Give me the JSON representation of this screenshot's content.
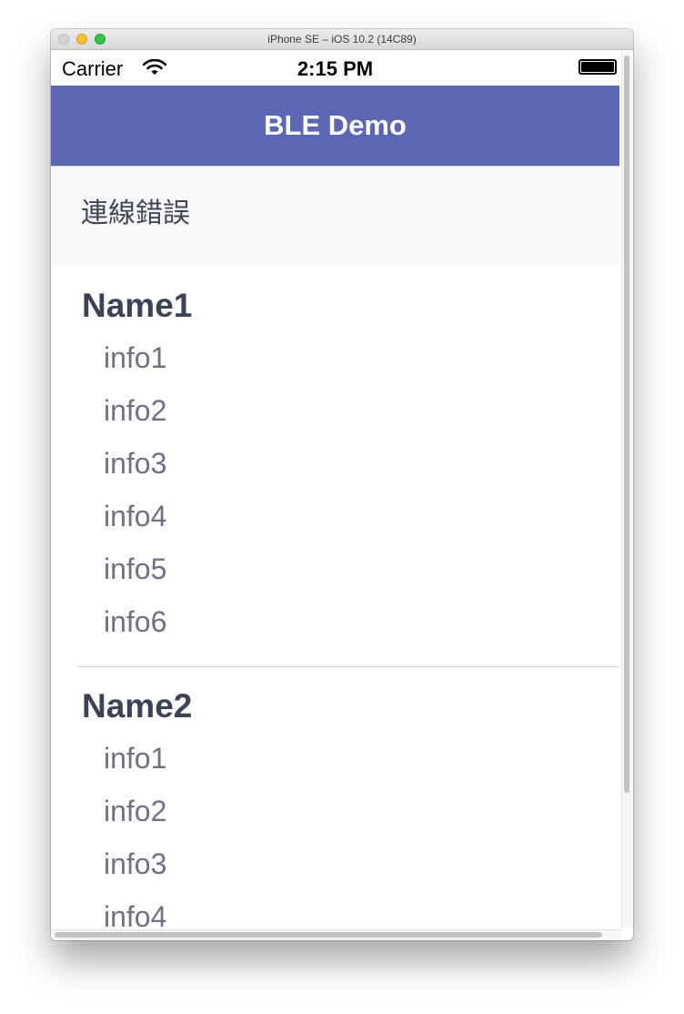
{
  "window": {
    "title": "iPhone SE – iOS 10.2 (14C89)"
  },
  "status_bar": {
    "carrier": "Carrier",
    "time": "2:15 PM"
  },
  "nav_bar": {
    "title": "BLE Demo",
    "background_color": "#5b66b4"
  },
  "error": {
    "message": "連線錯誤"
  },
  "devices": [
    {
      "name": "Name1",
      "info": [
        "info1",
        "info2",
        "info3",
        "info4",
        "info5",
        "info6"
      ]
    },
    {
      "name": "Name2",
      "info": [
        "info1",
        "info2",
        "info3",
        "info4"
      ]
    }
  ]
}
